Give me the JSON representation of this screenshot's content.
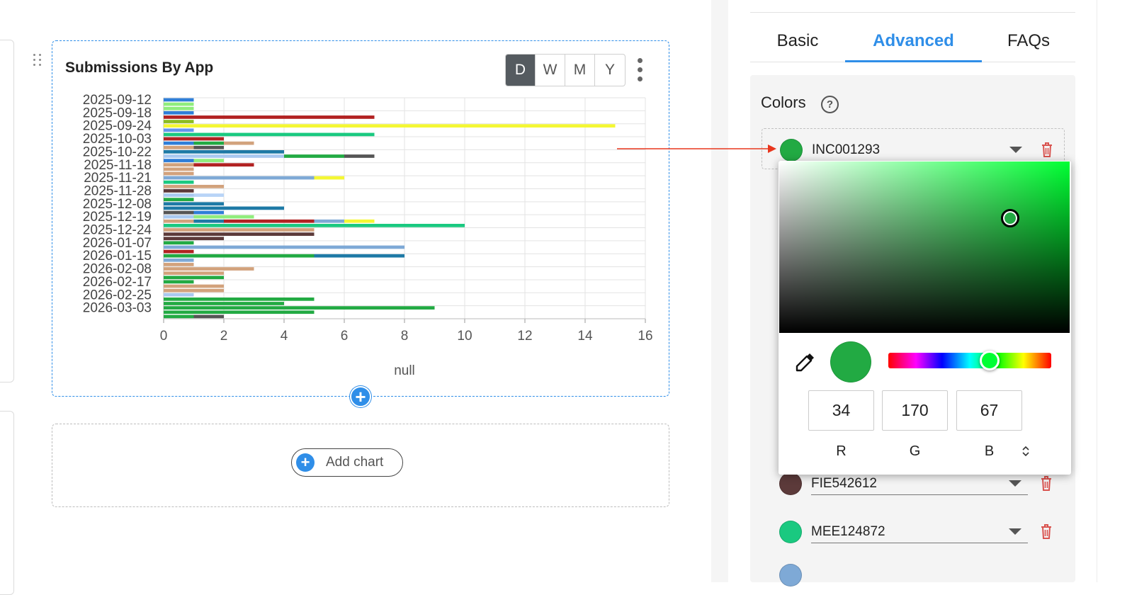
{
  "chart": {
    "title": "Submissions By App",
    "periods": [
      {
        "label": "D",
        "active": true
      },
      {
        "label": "W",
        "active": false
      },
      {
        "label": "M",
        "active": false
      },
      {
        "label": "Y",
        "active": false
      }
    ]
  },
  "chart_data": {
    "type": "bar",
    "orientation": "horizontal",
    "stacked": true,
    "title": "Submissions By App",
    "xlabel": "null",
    "ylabel": "",
    "xlim": [
      0,
      16
    ],
    "xticks": [
      0,
      2,
      4,
      6,
      8,
      10,
      12,
      14,
      16
    ],
    "grid": true,
    "visible_category_labels": [
      "2025-09-12",
      "2025-09-18",
      "2025-09-24",
      "2025-10-03",
      "2025-10-22",
      "2025-11-18",
      "2025-11-21",
      "2025-11-28",
      "2025-12-08",
      "2025-12-19",
      "2025-12-24",
      "2026-01-07",
      "2026-01-15",
      "2026-02-08",
      "2026-02-17",
      "2026-02-25",
      "2026-03-03"
    ],
    "rows": [
      [
        {
          "v": 1,
          "c": "#2f7ed8"
        }
      ],
      [
        {
          "v": 1,
          "c": "#90ed7d"
        }
      ],
      [
        {
          "v": 1,
          "c": "#90ed7d"
        }
      ],
      [
        {
          "v": 1,
          "c": "#2f7ed8"
        }
      ],
      [
        {
          "v": 7,
          "c": "#b22222"
        }
      ],
      [
        {
          "v": 1,
          "c": "#8bbc21"
        }
      ],
      [
        {
          "v": 15,
          "c": "#f4f733"
        }
      ],
      [
        {
          "v": 1,
          "c": "#6495ed"
        }
      ],
      [
        {
          "v": 7,
          "c": "#1ac980"
        }
      ],
      [
        {
          "v": 1,
          "c": "#b22222"
        },
        {
          "v": 1,
          "c": "#b22222"
        }
      ],
      [
        {
          "v": 1,
          "c": "#2f7ed8"
        },
        {
          "v": 1,
          "c": "#22aa43"
        },
        {
          "v": 1,
          "c": "#d2a27c"
        }
      ],
      [
        {
          "v": 1,
          "c": "#d2a27c"
        },
        {
          "v": 1,
          "c": "#555555"
        }
      ],
      [
        {
          "v": 4,
          "c": "#1e7aa6"
        }
      ],
      [
        {
          "v": 4,
          "c": "#a9c9f0"
        },
        {
          "v": 2,
          "c": "#22aa43"
        },
        {
          "v": 1,
          "c": "#555555"
        }
      ],
      [
        {
          "v": 1,
          "c": "#2f7ed8"
        },
        {
          "v": 1,
          "c": "#90ed7d"
        }
      ],
      [
        {
          "v": 1,
          "c": "#d2a27c"
        },
        {
          "v": 2,
          "c": "#b22222"
        }
      ],
      [
        {
          "v": 1,
          "c": "#d2a27c"
        }
      ],
      [
        {
          "v": 1,
          "c": "#d2a27c"
        }
      ],
      [
        {
          "v": 5,
          "c": "#7ea9d6"
        },
        {
          "v": 1,
          "c": "#f4f733"
        }
      ],
      [
        {
          "v": 1,
          "c": "#1ac980"
        }
      ],
      [
        {
          "v": 2,
          "c": "#d2a27c"
        }
      ],
      [
        {
          "v": 1,
          "c": "#5c3a3a"
        }
      ],
      [
        {
          "v": 1,
          "c": "#a9c9f0"
        },
        {
          "v": 1,
          "c": "#b8d4f7"
        }
      ],
      [
        {
          "v": 1,
          "c": "#22aa43"
        }
      ],
      [
        {
          "v": 2,
          "c": "#1e7aa6"
        }
      ],
      [
        {
          "v": 4,
          "c": "#1e7aa6"
        }
      ],
      [
        {
          "v": 1,
          "c": "#555555"
        },
        {
          "v": 1,
          "c": "#2f7ed8"
        }
      ],
      [
        {
          "v": 1,
          "c": "#a9c9f0"
        },
        {
          "v": 2,
          "c": "#90ed7d"
        }
      ],
      [
        {
          "v": 1,
          "c": "#d2a27c"
        },
        {
          "v": 1,
          "c": "#1e7aa6"
        },
        {
          "v": 3,
          "c": "#b22222"
        },
        {
          "v": 1,
          "c": "#7ea9d6"
        },
        {
          "v": 1,
          "c": "#f4f733"
        }
      ],
      [
        {
          "v": 10,
          "c": "#1ac980"
        }
      ],
      [
        {
          "v": 5,
          "c": "#d2a27c"
        }
      ],
      [
        {
          "v": 5,
          "c": "#5c3a3a"
        }
      ],
      [
        {
          "v": 2,
          "c": "#5c3a3a"
        }
      ],
      [
        {
          "v": 1,
          "c": "#22aa43"
        }
      ],
      [
        {
          "v": 8,
          "c": "#7ea9d6"
        }
      ],
      [
        {
          "v": 1,
          "c": "#b22222"
        }
      ],
      [
        {
          "v": 5,
          "c": "#22aa43"
        },
        {
          "v": 3,
          "c": "#1e7aa6"
        }
      ],
      [
        {
          "v": 1,
          "c": "#7ea9d6"
        }
      ],
      [
        {
          "v": 1,
          "c": "#d2a27c"
        }
      ],
      [
        {
          "v": 3,
          "c": "#d2a27c"
        }
      ],
      [
        {
          "v": 2,
          "c": "#d2a27c"
        }
      ],
      [
        {
          "v": 2,
          "c": "#22aa43"
        }
      ],
      [
        {
          "v": 1,
          "c": "#22aa43"
        }
      ],
      [
        {
          "v": 2,
          "c": "#d2a27c"
        }
      ],
      [
        {
          "v": 2,
          "c": "#d2a27c"
        }
      ],
      [
        {
          "v": 1,
          "c": "#a9c9f0"
        }
      ],
      [
        {
          "v": 5,
          "c": "#22aa43"
        }
      ],
      [
        {
          "v": 4,
          "c": "#22aa43"
        }
      ],
      [
        {
          "v": 9,
          "c": "#22aa43"
        }
      ],
      [
        {
          "v": 5,
          "c": "#22aa43"
        }
      ],
      [
        {
          "v": 1,
          "c": "#22aa43"
        },
        {
          "v": 1,
          "c": "#555555"
        }
      ]
    ]
  },
  "add_chart": {
    "label": "Add chart"
  },
  "tabs": [
    {
      "label": "Basic",
      "active": false
    },
    {
      "label": "Advanced",
      "active": true
    },
    {
      "label": "FAQs",
      "active": false
    }
  ],
  "colors_section": {
    "label": "Colors",
    "help_icon": "?",
    "entries": [
      {
        "name": "INC001293",
        "color": "#22aa43"
      },
      {
        "name": "FIE542612",
        "color": "#5c3a3a"
      },
      {
        "name": "MEE124872",
        "color": "#1ac980"
      }
    ]
  },
  "picker": {
    "hue_color": "#00ff33",
    "current_color": "#22aa43",
    "r": "34",
    "g": "170",
    "b": "67",
    "r_label": "R",
    "g_label": "G",
    "b_label": "B"
  },
  "accent_color": "#2f8ee8",
  "arrow_color": "#e8361d"
}
